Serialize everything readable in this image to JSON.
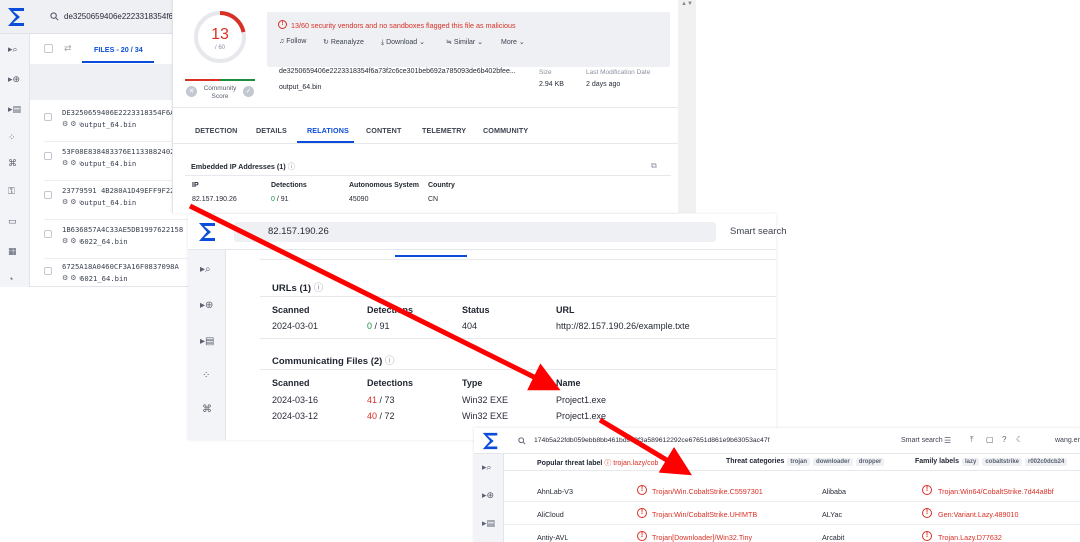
{
  "panel_files": {
    "search_query": "de3250659406e2223318354f6a73",
    "tab_label": "FILES - 20 / 34",
    "rows": [
      {
        "hash": "DE3250659406E2223318354F6A73",
        "name": "output_64.bin"
      },
      {
        "hash": "53F08E838483376E11338824028",
        "name": "output_64.bin"
      },
      {
        "hash": "23779591 4B280A1D49EFF9F22CB",
        "name": "output_64.bin"
      },
      {
        "hash": "1B636857A4C33AE5DB1997622158",
        "name": "6022_64.bin"
      },
      {
        "hash": "6725A18A0460CF3A16F0837098A",
        "name": "6021_64.bin"
      }
    ]
  },
  "panel_report": {
    "score_value": "13",
    "score_total": "/ 60",
    "community_label": "Community Score",
    "alert": "13/60 security vendors and no sandboxes flagged this file as malicious",
    "actions": [
      "Follow",
      "Reanalyze",
      "Download",
      "Similar",
      "More"
    ],
    "file_hash": "de3250659406e2223318354f6a73f2c6ce301beb692a785093de6b402bfee...",
    "file_name": "output_64.bin",
    "size_label": "Size",
    "size_value": "2.94 KB",
    "lastmod_label": "Last Modification Date",
    "lastmod_value": "2 days ago",
    "tabs": [
      "DETECTION",
      "DETAILS",
      "RELATIONS",
      "CONTENT",
      "TELEMETRY",
      "COMMUNITY"
    ],
    "active_tab": "RELATIONS",
    "embedded_title": "Embedded IP Addresses",
    "embedded_count": "(1)",
    "columns": [
      "IP",
      "Detections",
      "Autonomous System",
      "Country"
    ],
    "row": {
      "ip": "82.157.190.26",
      "det_hit": "0",
      "det_total": "/ 91",
      "as": "45090",
      "country": "CN"
    }
  },
  "panel_ip": {
    "search_value": "82.157.190.26",
    "smart_search": "Smart search",
    "urls_title": "URLs",
    "urls_count": "(1)",
    "url_columns": [
      "Scanned",
      "Detections",
      "Status",
      "URL"
    ],
    "url_row": {
      "scanned": "2024-03-01",
      "det_hit": "0",
      "det_total": "/ 91",
      "status": "404",
      "url": "http://82.157.190.26/example.txte"
    },
    "comm_title": "Communicating Files",
    "comm_count": "(2)",
    "comm_columns": [
      "Scanned",
      "Detections",
      "Type",
      "Name"
    ],
    "comm_rows": [
      {
        "scanned": "2024-03-16",
        "det_hit": "41",
        "det_total": "/ 73",
        "type": "Win32 EXE",
        "name": "Project1.exe"
      },
      {
        "scanned": "2024-03-12",
        "det_hit": "40",
        "det_total": "/ 72",
        "type": "Win32 EXE",
        "name": "Project1.exe"
      }
    ]
  },
  "panel_det": {
    "search_value": "174b5a22fdb059ebb8bb461bd9e0f3a589612292ce67651d861e9b63053ac47f",
    "smart_search": "Smart search",
    "user": "wang.er",
    "popular_label": "Popular threat label",
    "popular_value": "trojan.lazy/cob",
    "categories_label": "Threat categories",
    "categories": [
      "trojan",
      "downloader",
      "dropper"
    ],
    "family_label": "Family labels",
    "families": [
      "lazy",
      "cobaltstrike",
      "r002c0dcb24"
    ],
    "rows": [
      {
        "engine": "AhnLab-V3",
        "result": "Trojan/Win.CobaltStrike.C5597301",
        "engine2": "Alibaba",
        "result2": "Trojan:Win64/CobaltStrike.7d44a8bf"
      },
      {
        "engine": "AliCloud",
        "result": "Trojan:Win/CobaltStrike.UH!MTB",
        "engine2": "ALYac",
        "result2": "Gen:Variant.Lazy.489010"
      },
      {
        "engine": "Antiy-AVL",
        "result": "Trojan[Downloader]/Win32.Tiny",
        "engine2": "Arcabit",
        "result2": "Trojan.Lazy.D77632"
      }
    ]
  },
  "colors": {
    "alert_red": "#d93025",
    "accent_blue": "#0b4dda",
    "arrow_red": "#ff0000",
    "ok_green": "#1e8e3e"
  }
}
